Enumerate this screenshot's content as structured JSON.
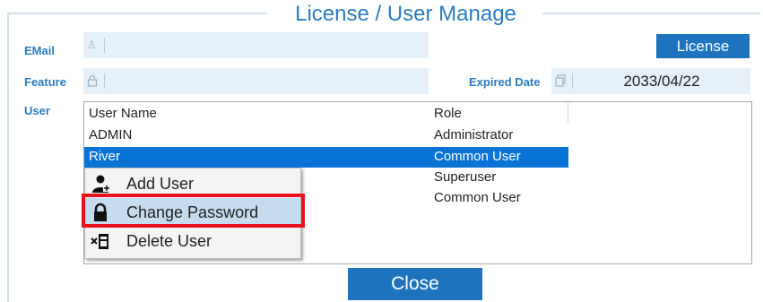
{
  "dialog": {
    "title": "License / User Manage"
  },
  "labels": {
    "email": "EMail",
    "feature": "Feature",
    "user": "User",
    "expired_date": "Expired Date"
  },
  "fields": {
    "email_value": "",
    "feature_value": "",
    "expired_date_value": "2033/04/22"
  },
  "buttons": {
    "license": "License",
    "close": "Close"
  },
  "user_list": {
    "columns": [
      "User Name",
      "Role"
    ],
    "rows": [
      {
        "name": "ADMIN",
        "role": "Administrator"
      },
      {
        "name": "River",
        "role": "Common User",
        "selected": true
      },
      {
        "name": "",
        "role": "Superuser"
      },
      {
        "name": "",
        "role": "Common User"
      }
    ]
  },
  "context_menu": {
    "items": [
      {
        "label": "Add User",
        "icon": "add-user-icon"
      },
      {
        "label": "Change Password",
        "icon": "lock-icon",
        "highlighted": true
      },
      {
        "label": "Delete User",
        "icon": "delete-user-icon"
      }
    ]
  },
  "colors": {
    "accent": "#1e73be",
    "selection": "#0a74d6",
    "highlight_border": "#e8121d",
    "label_blue": "#2a7cc0"
  }
}
